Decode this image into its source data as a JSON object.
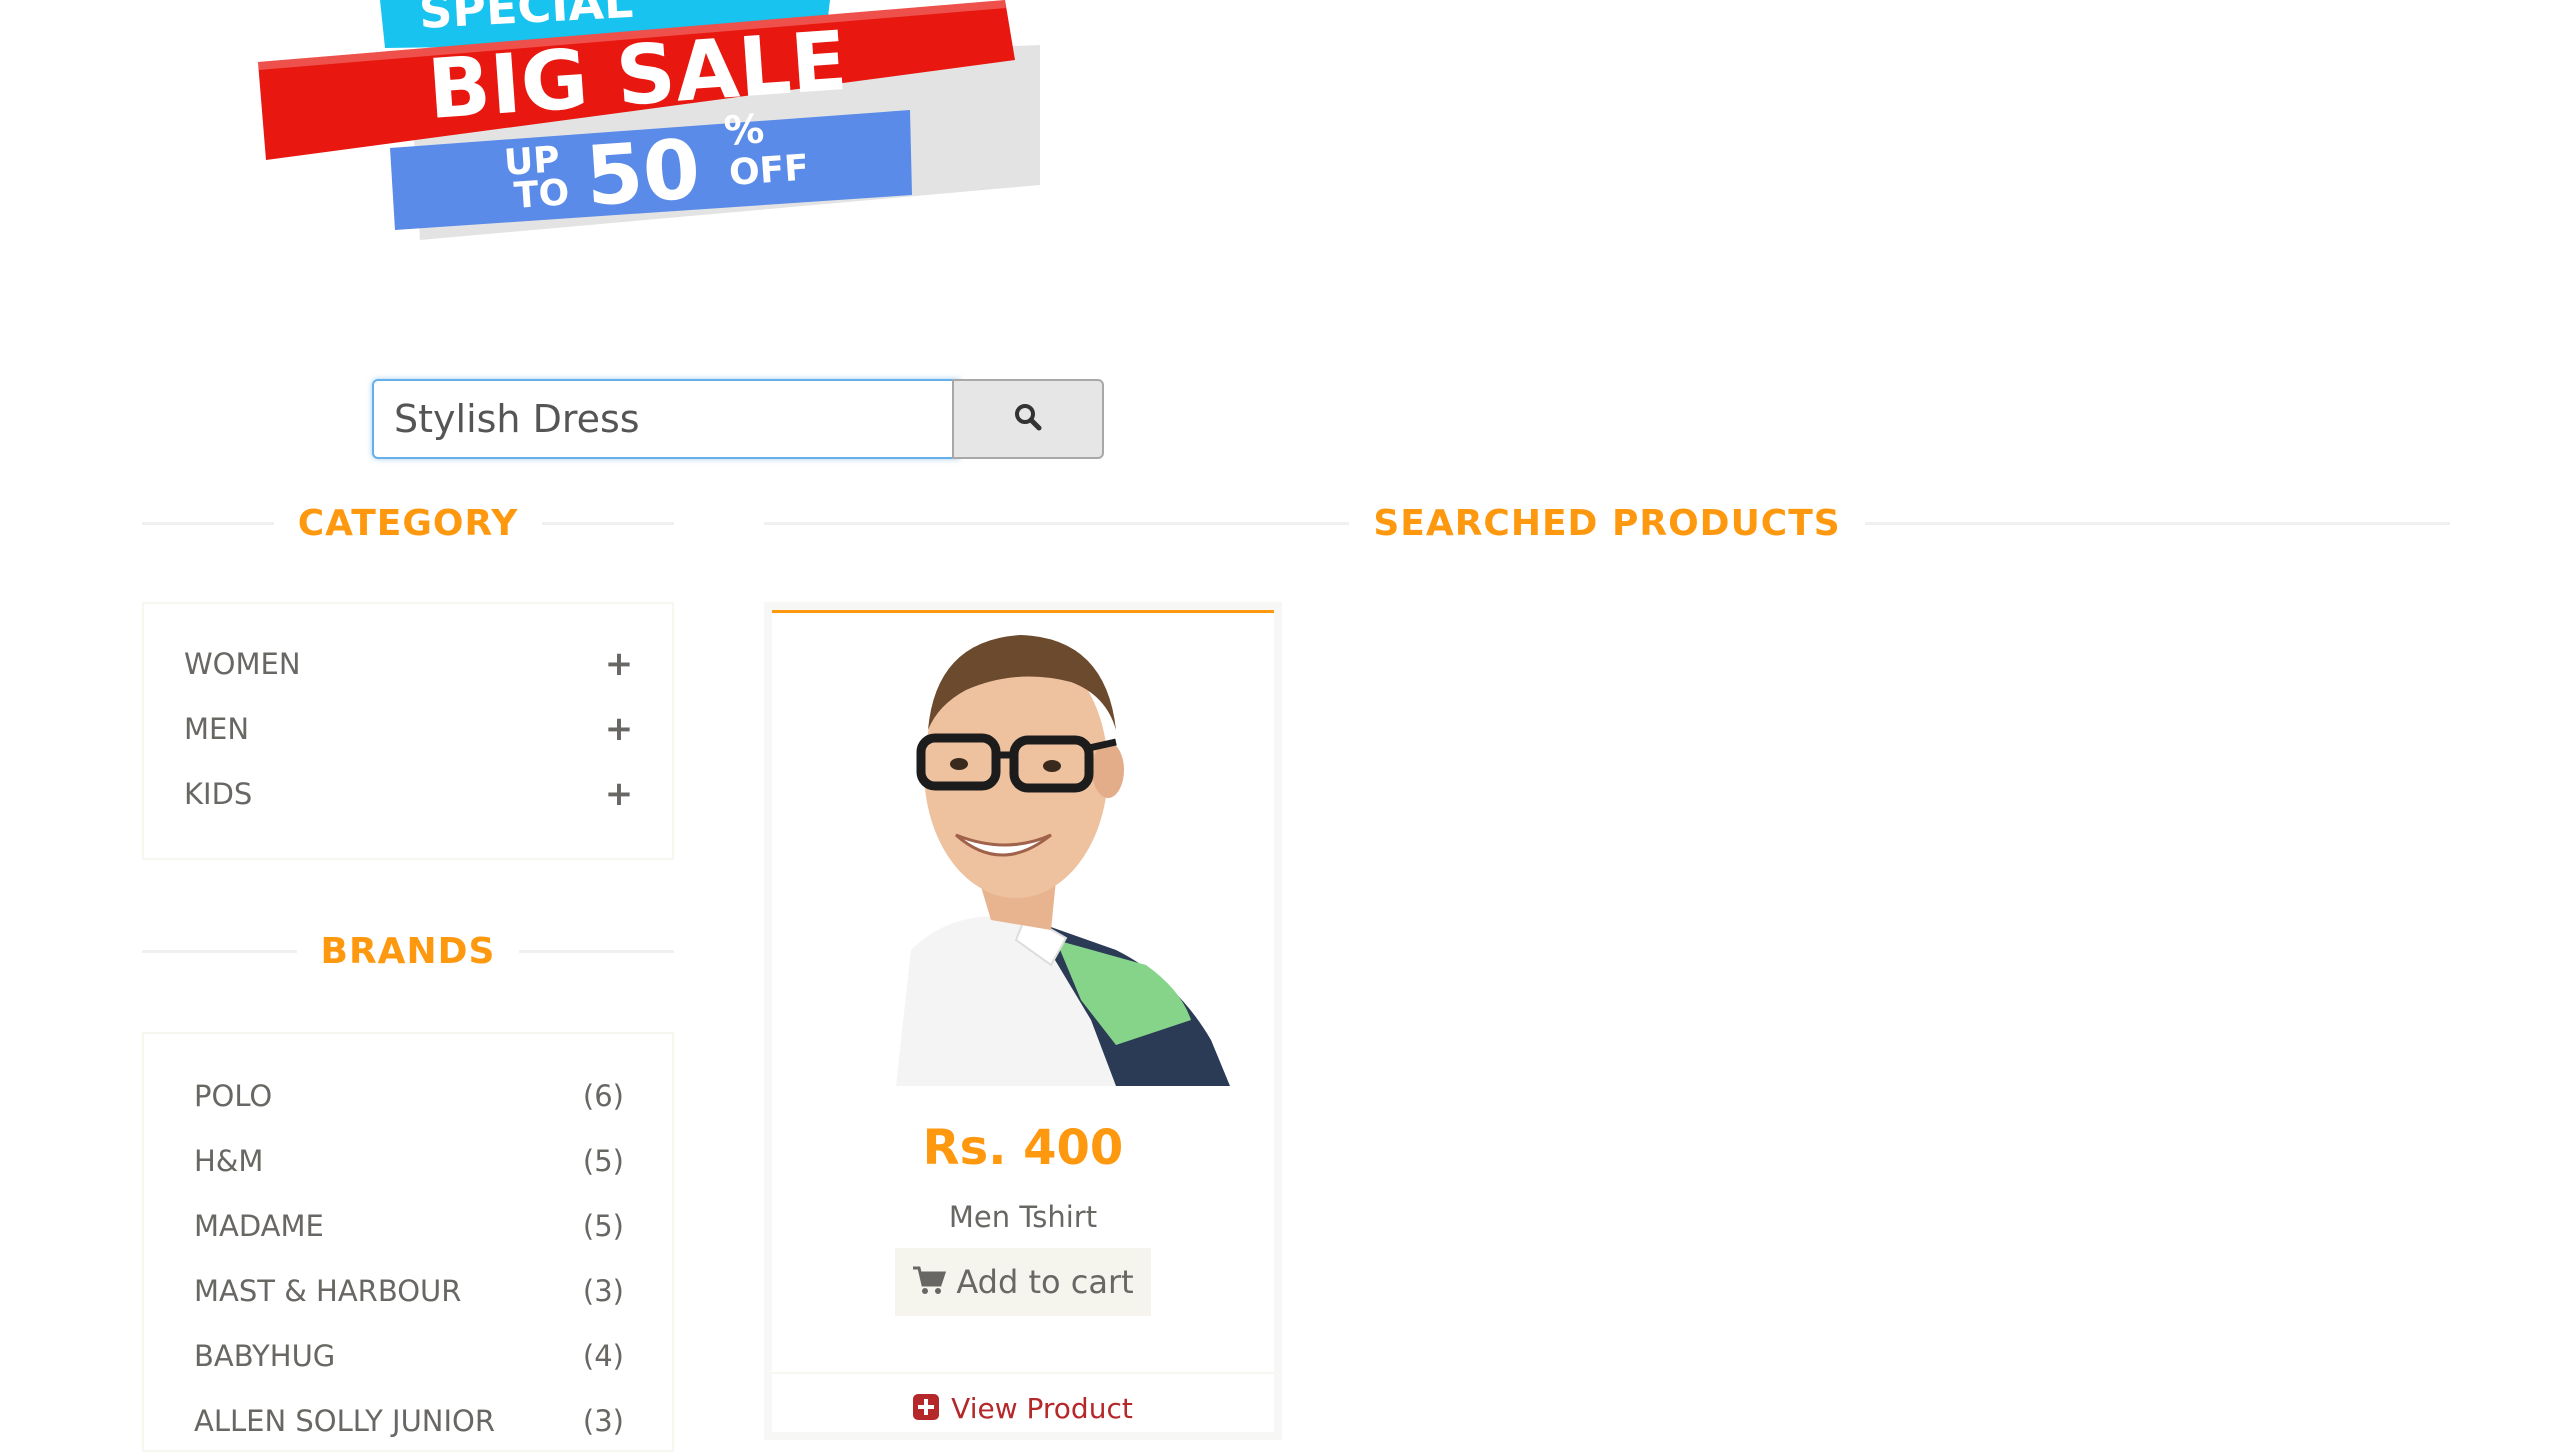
{
  "banner": {
    "top_text": "SPECIAL",
    "headline": "BIG SALE",
    "sub_up": "UP",
    "sub_to": "TO",
    "discount": "50",
    "percent": "%",
    "off": "OFF"
  },
  "search": {
    "value": "Stylish Dress",
    "icon": "search-icon"
  },
  "category": {
    "title": "CATEGORY",
    "items": [
      {
        "label": "WOMEN",
        "icon": "plus-icon"
      },
      {
        "label": "MEN",
        "icon": "plus-icon"
      },
      {
        "label": "KIDS",
        "icon": "plus-icon"
      }
    ]
  },
  "brands": {
    "title": "BRANDS",
    "items": [
      {
        "label": "POLO",
        "count": "(6)"
      },
      {
        "label": "H&M",
        "count": "(5)"
      },
      {
        "label": "MADAME",
        "count": "(5)"
      },
      {
        "label": "MAST & HARBOUR",
        "count": "(3)"
      },
      {
        "label": "BABYHUG",
        "count": "(4)"
      },
      {
        "label": "ALLEN SOLLY JUNIOR",
        "count": "(3)"
      }
    ]
  },
  "results": {
    "title": "SEARCHED PRODUCTS",
    "products": [
      {
        "price": "Rs. 400",
        "name": "Men Tshirt",
        "add_to_cart_label": "Add to cart",
        "view_label": "View Product"
      }
    ]
  },
  "colors": {
    "accent": "#fe980f",
    "text": "#696763",
    "link": "#b4282a",
    "banner_red": "#e8170f",
    "banner_blue": "#5b8be8",
    "banner_cyan": "#19c3ef"
  }
}
